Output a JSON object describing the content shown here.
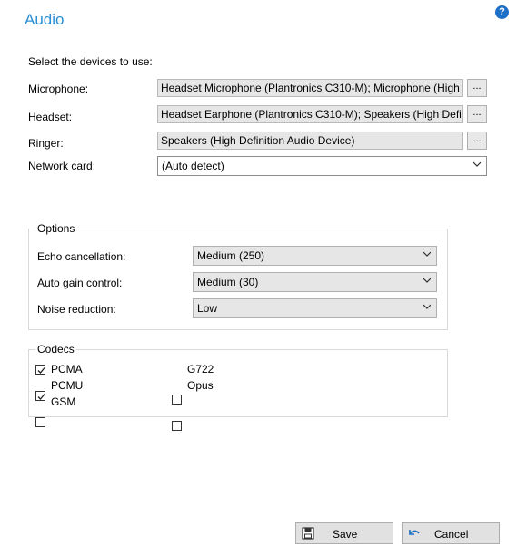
{
  "header": {
    "title": "Audio",
    "help_icon": "?"
  },
  "devices": {
    "intro": "Select the devices to use:",
    "microphone": {
      "label": "Microphone:",
      "value": "Headset Microphone (Plantronics C310-M); Microphone (High"
    },
    "headset": {
      "label": "Headset:",
      "value": "Headset Earphone (Plantronics C310-M); Speakers (High Defini"
    },
    "ringer": {
      "label": "Ringer:",
      "value": "Speakers (High Definition Audio Device)"
    },
    "browse_label": "...",
    "network": {
      "label": "Network card:",
      "value": "(Auto detect)"
    }
  },
  "options": {
    "title": "Options",
    "echo": {
      "label": "Echo cancellation:",
      "value": "Medium (250)"
    },
    "agc": {
      "label": "Auto gain control:",
      "value": "Medium (30)"
    },
    "noise": {
      "label": "Noise reduction:",
      "value": "Low"
    }
  },
  "codecs": {
    "title": "Codecs",
    "items": [
      {
        "label": "PCMA",
        "checked": true
      },
      {
        "label": "PCMU",
        "checked": true
      },
      {
        "label": "GSM",
        "checked": false
      },
      {
        "label": "G722",
        "checked": false
      },
      {
        "label": "Opus",
        "checked": false
      }
    ]
  },
  "footer": {
    "save_label": "Save",
    "cancel_label": "Cancel"
  }
}
